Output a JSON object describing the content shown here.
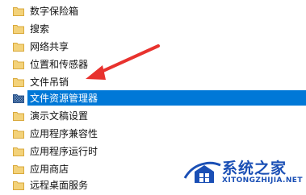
{
  "tree": {
    "items": [
      {
        "label": "数字保险箱",
        "selected": false
      },
      {
        "label": "搜索",
        "selected": false
      },
      {
        "label": "网络共享",
        "selected": false
      },
      {
        "label": "位置和传感器",
        "selected": false
      },
      {
        "label": "文件吊销",
        "selected": false
      },
      {
        "label": "文件资源管理器",
        "selected": true
      },
      {
        "label": "演示文稿设置",
        "selected": false
      },
      {
        "label": "应用程序兼容性",
        "selected": false
      },
      {
        "label": "应用程序运行时",
        "selected": false
      },
      {
        "label": "应用商店",
        "selected": false
      },
      {
        "label": "远程桌面服务",
        "selected": false
      }
    ]
  },
  "colors": {
    "selection": "#0078d7",
    "folder_fill": "#f3d27a",
    "folder_edge": "#d9a93c",
    "arrow": "#e8322e",
    "watermark": "#1a4fb5"
  },
  "watermark": {
    "brand": "系统之家",
    "url": "XITONGZHIJIA.NET"
  }
}
